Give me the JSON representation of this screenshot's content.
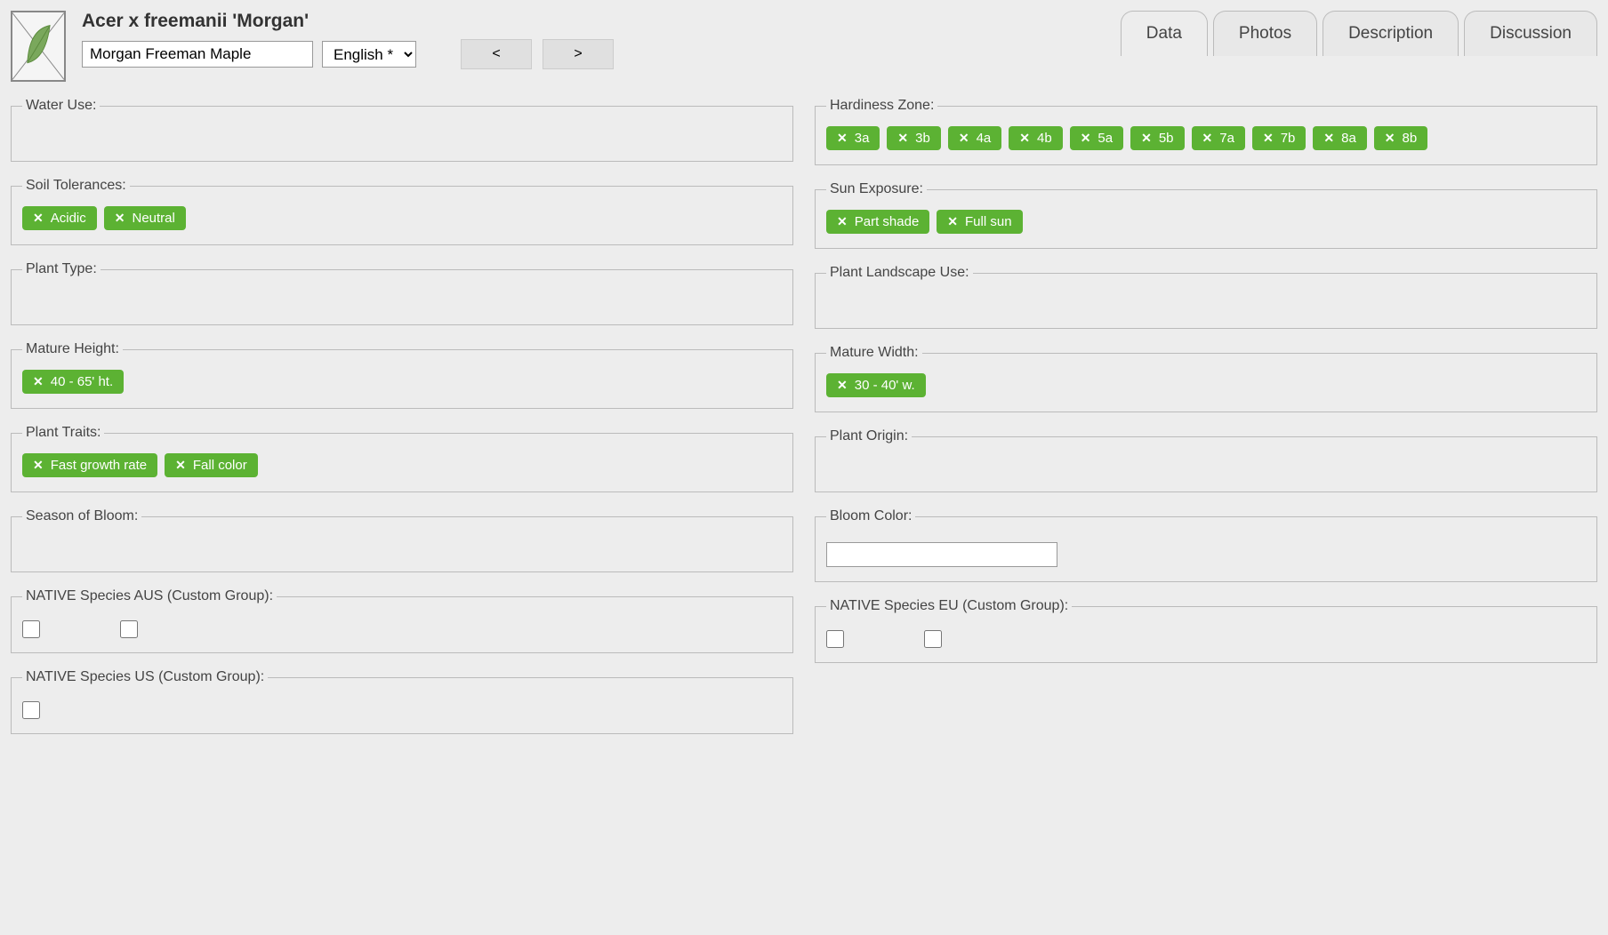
{
  "header": {
    "title": "Acer x freemanii 'Morgan'",
    "name_value": "Morgan Freeman Maple",
    "language": "English *",
    "nav_prev": "<",
    "nav_next": ">"
  },
  "tabs": [
    {
      "label": "Data",
      "active": true
    },
    {
      "label": "Photos",
      "active": false
    },
    {
      "label": "Description",
      "active": false
    },
    {
      "label": "Discussion",
      "active": false
    }
  ],
  "fields": {
    "left": [
      {
        "legend": "Water Use:",
        "type": "tags",
        "tags": []
      },
      {
        "legend": "Soil Tolerances:",
        "type": "tags",
        "tags": [
          "Acidic",
          "Neutral"
        ]
      },
      {
        "legend": "Plant Type:",
        "type": "tags",
        "tags": []
      },
      {
        "legend": "Mature Height:",
        "type": "tags",
        "tags": [
          "40 - 65' ht."
        ]
      },
      {
        "legend": "Plant Traits:",
        "type": "tags",
        "tags": [
          "Fast growth rate",
          "Fall color"
        ]
      },
      {
        "legend": "Season of Bloom:",
        "type": "tags",
        "tags": []
      },
      {
        "legend": "NATIVE Species AUS (Custom Group):",
        "type": "checkboxes",
        "count": 2
      },
      {
        "legend": "NATIVE Species US (Custom Group):",
        "type": "checkboxes",
        "count": 1
      }
    ],
    "right": [
      {
        "legend": "Hardiness Zone:",
        "type": "tags",
        "tags": [
          "3a",
          "3b",
          "4a",
          "4b",
          "5a",
          "5b",
          "7a",
          "7b",
          "8a",
          "8b"
        ]
      },
      {
        "legend": "Sun Exposure:",
        "type": "tags",
        "tags": [
          "Part shade",
          "Full sun"
        ]
      },
      {
        "legend": "Plant Landscape Use:",
        "type": "tags",
        "tags": []
      },
      {
        "legend": "Mature Width:",
        "type": "tags",
        "tags": [
          "30 - 40' w."
        ]
      },
      {
        "legend": "Plant Origin:",
        "type": "tags",
        "tags": []
      },
      {
        "legend": "Bloom Color:",
        "type": "color",
        "value": ""
      },
      {
        "legend": "NATIVE Species EU (Custom Group):",
        "type": "checkboxes",
        "count": 2
      }
    ]
  },
  "colors": {
    "tag_bg": "#5cb233"
  }
}
